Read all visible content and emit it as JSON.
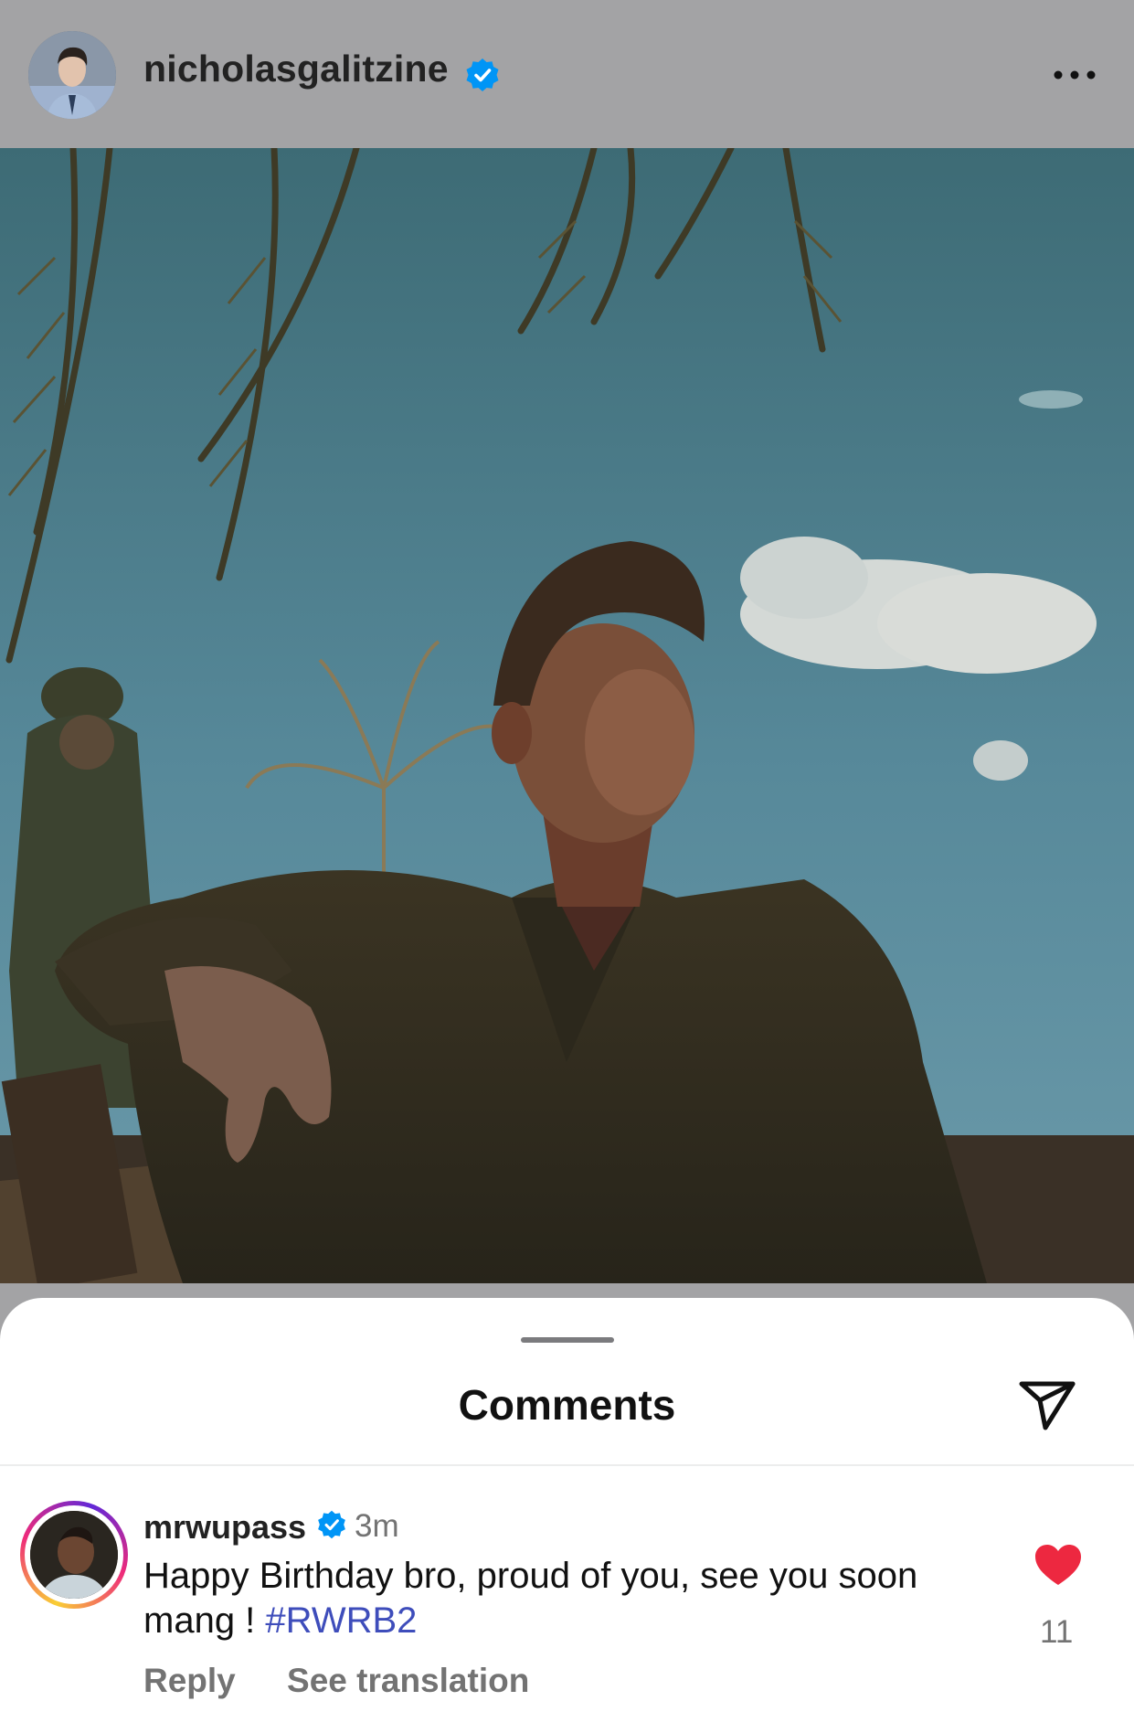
{
  "post": {
    "username": "nicholasgalitzine",
    "verified": true,
    "more_icon": "more-horizontal-icon"
  },
  "comments_sheet": {
    "title": "Comments",
    "share_icon": "send-icon"
  },
  "comment": {
    "username": "mrwupass",
    "verified": true,
    "time": "3m",
    "text": "Happy Birthday bro, proud of you, see you soon mang ! ",
    "hashtag": "#RWRB2",
    "reply_label": "Reply",
    "translate_label": "See translation",
    "liked": true,
    "like_count": "11"
  },
  "colors": {
    "background": "#a3a3a5",
    "sheet": "#ffffff",
    "verified": "#0095f6",
    "hashtag": "#3e4dbb",
    "like": "#ed2840",
    "secondary_text": "#737373"
  }
}
